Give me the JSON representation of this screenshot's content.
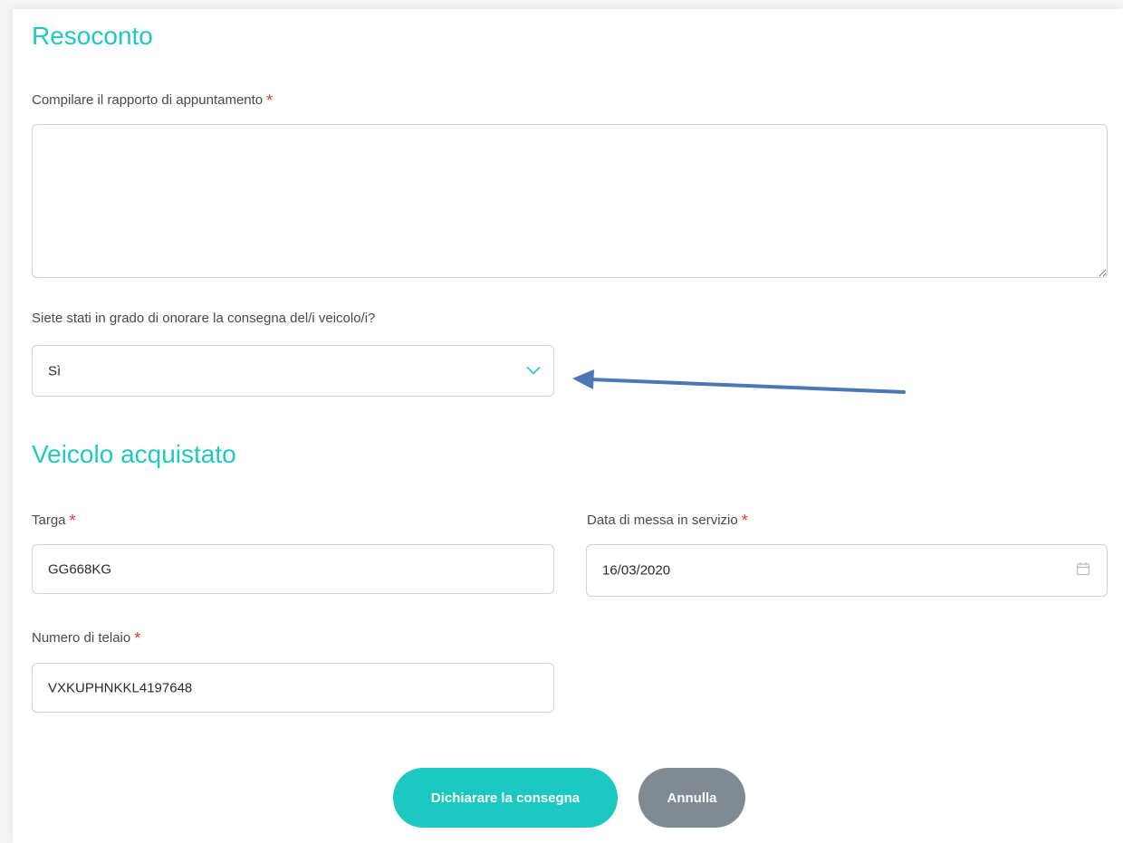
{
  "resoconto": {
    "title": "Resoconto",
    "report_label": "Compilare il rapporto di appuntamento",
    "required_mark": "*",
    "report_value": "",
    "delivery_question": "Siete stati in grado di onorare la consegna del/i veicolo/i?",
    "delivery_selected": "Sì"
  },
  "vehicle": {
    "title": "Veicolo acquistato",
    "plate_label": "Targa",
    "plate_value": "GG668KG",
    "date_label": "Data di messa in servizio",
    "date_value": "16/03/2020",
    "chassis_label": "Numero di telaio",
    "chassis_value": "VXKUPHNKKL4197648",
    "required_mark": "*"
  },
  "actions": {
    "declare_label": "Dichiarare la consegna",
    "cancel_label": "Annulla"
  },
  "icons": {
    "select": "chevron-down-icon",
    "date": "calendar-icon",
    "annotation": "arrow-left-icon"
  },
  "colors": {
    "accent": "#1fc9c3",
    "primary_button": "#1cc9c2",
    "secondary_button": "#7f8a92",
    "required": "#e53935",
    "annotation_arrow": "#4a78b5"
  }
}
